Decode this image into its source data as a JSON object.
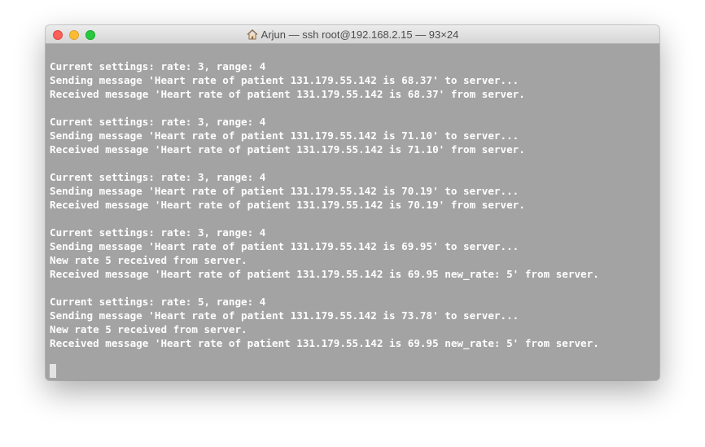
{
  "window": {
    "title": "Arjun — ssh root@192.168.2.15 — 93×24"
  },
  "terminal": {
    "lines": [
      "Current settings: rate: 3, range: 4",
      "Sending message 'Heart rate of patient 131.179.55.142 is 68.37' to server...",
      "Received message 'Heart rate of patient 131.179.55.142 is 68.37' from server.",
      "",
      "Current settings: rate: 3, range: 4",
      "Sending message 'Heart rate of patient 131.179.55.142 is 71.10' to server...",
      "Received message 'Heart rate of patient 131.179.55.142 is 71.10' from server.",
      "",
      "Current settings: rate: 3, range: 4",
      "Sending message 'Heart rate of patient 131.179.55.142 is 70.19' to server...",
      "Received message 'Heart rate of patient 131.179.55.142 is 70.19' from server.",
      "",
      "Current settings: rate: 3, range: 4",
      "Sending message 'Heart rate of patient 131.179.55.142 is 69.95' to server...",
      "New rate 5 received from server.",
      "Received message 'Heart rate of patient 131.179.55.142 is 69.95 new_rate: 5' from server.",
      "",
      "Current settings: rate: 5, range: 4",
      "Sending message 'Heart rate of patient 131.179.55.142 is 73.78' to server...",
      "New rate 5 received from server.",
      "Received message 'Heart rate of patient 131.179.55.142 is 69.95 new_rate: 5' from server."
    ]
  },
  "icons": {
    "close": "close-icon",
    "minimize": "minimize-icon",
    "maximize": "maximize-icon",
    "home": "home-icon"
  },
  "colors": {
    "terminal_background": "#a3a3a3",
    "terminal_text": "#ffffff",
    "close": "#fc5f57",
    "minimize": "#fdbc2e",
    "maximize": "#28c840"
  }
}
